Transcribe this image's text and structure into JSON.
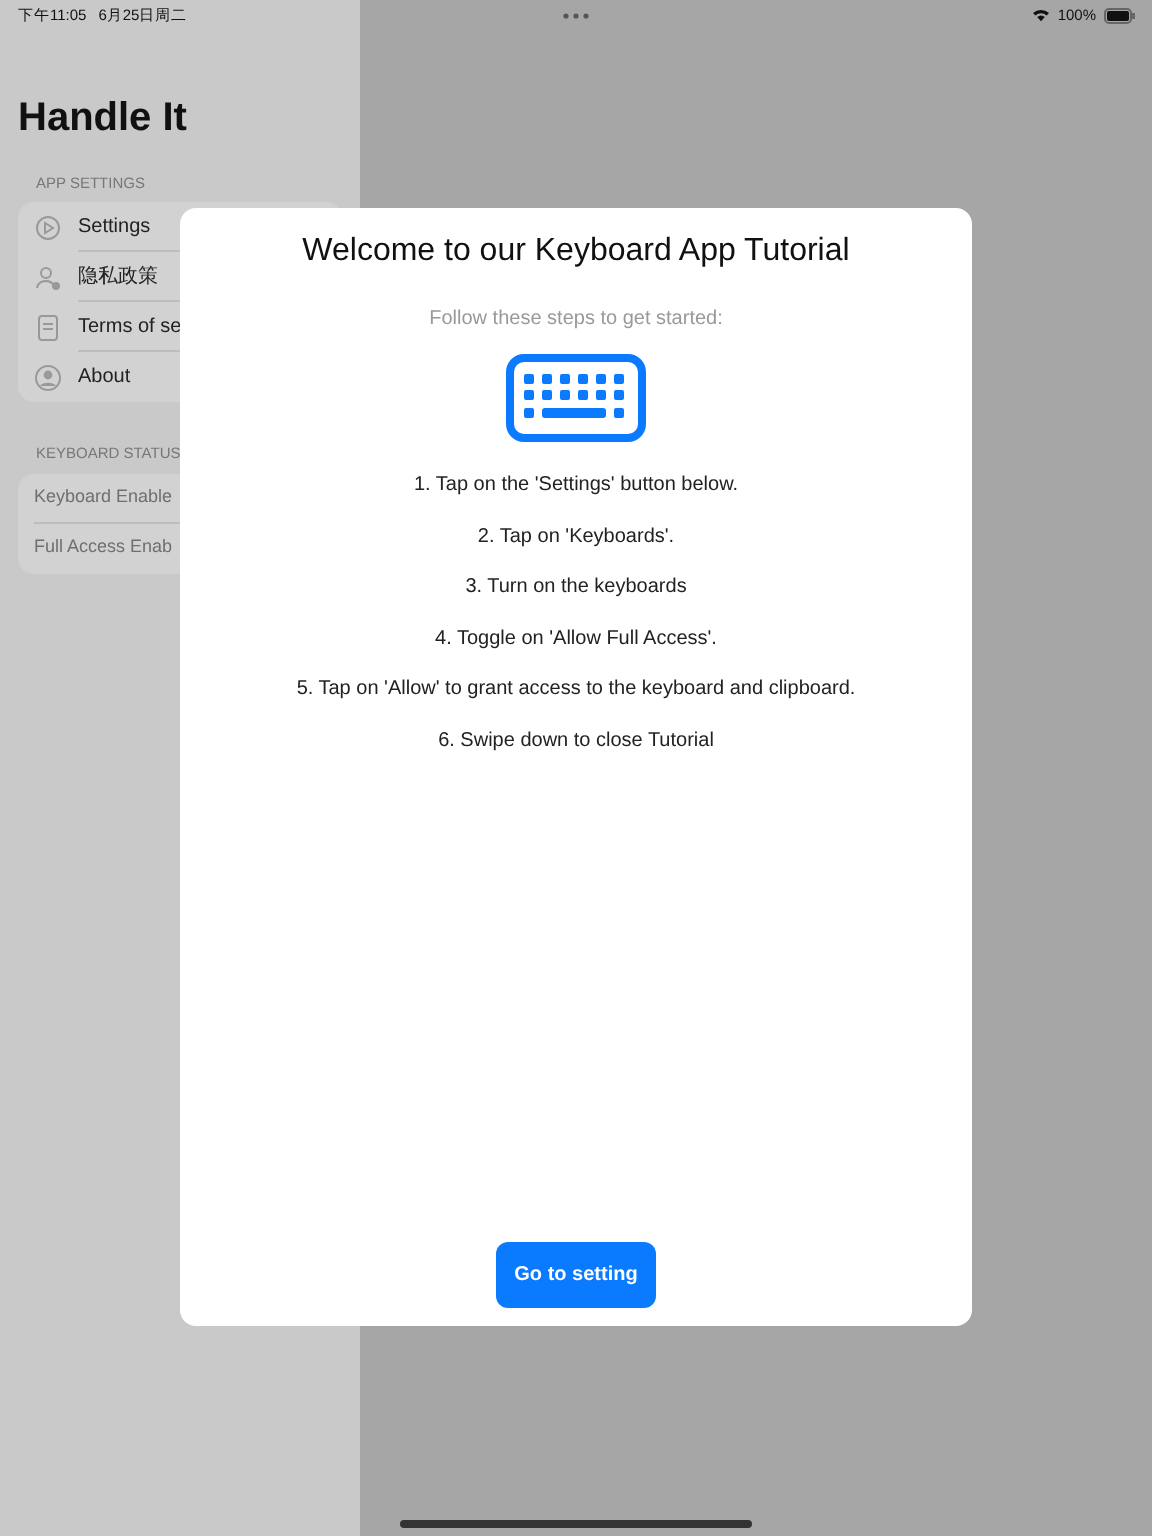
{
  "status_bar": {
    "time": "下午11:05",
    "date": "6月25日周二",
    "battery": "100%"
  },
  "sidebar": {
    "title": "Handle It",
    "sections": [
      {
        "header": "APP SETTINGS",
        "items": [
          {
            "label": "Settings",
            "kind": "play"
          },
          {
            "label": "隐私政策",
            "kind": "person"
          },
          {
            "label": "Terms of se",
            "kind": "doc"
          },
          {
            "label": "About",
            "kind": "avatar"
          }
        ]
      },
      {
        "header": "KEYBOARD STATUS",
        "items": [
          {
            "label": "Keyboard Enable",
            "kind": "status"
          },
          {
            "label": "Full Access Enab",
            "kind": "status"
          }
        ]
      }
    ]
  },
  "modal": {
    "title": "Welcome to our Keyboard App Tutorial",
    "subtitle": "Follow these steps to get started:",
    "steps": [
      "1. Tap on the 'Settings' button below.",
      "2. Tap on 'Keyboards'.",
      "3. Turn on the keyboards",
      "4. Toggle on 'Allow Full Access'.",
      "5. Tap on 'Allow' to grant access to the keyboard and clipboard.",
      "6. Swipe down to close Tutorial"
    ],
    "button": "Go to setting"
  }
}
